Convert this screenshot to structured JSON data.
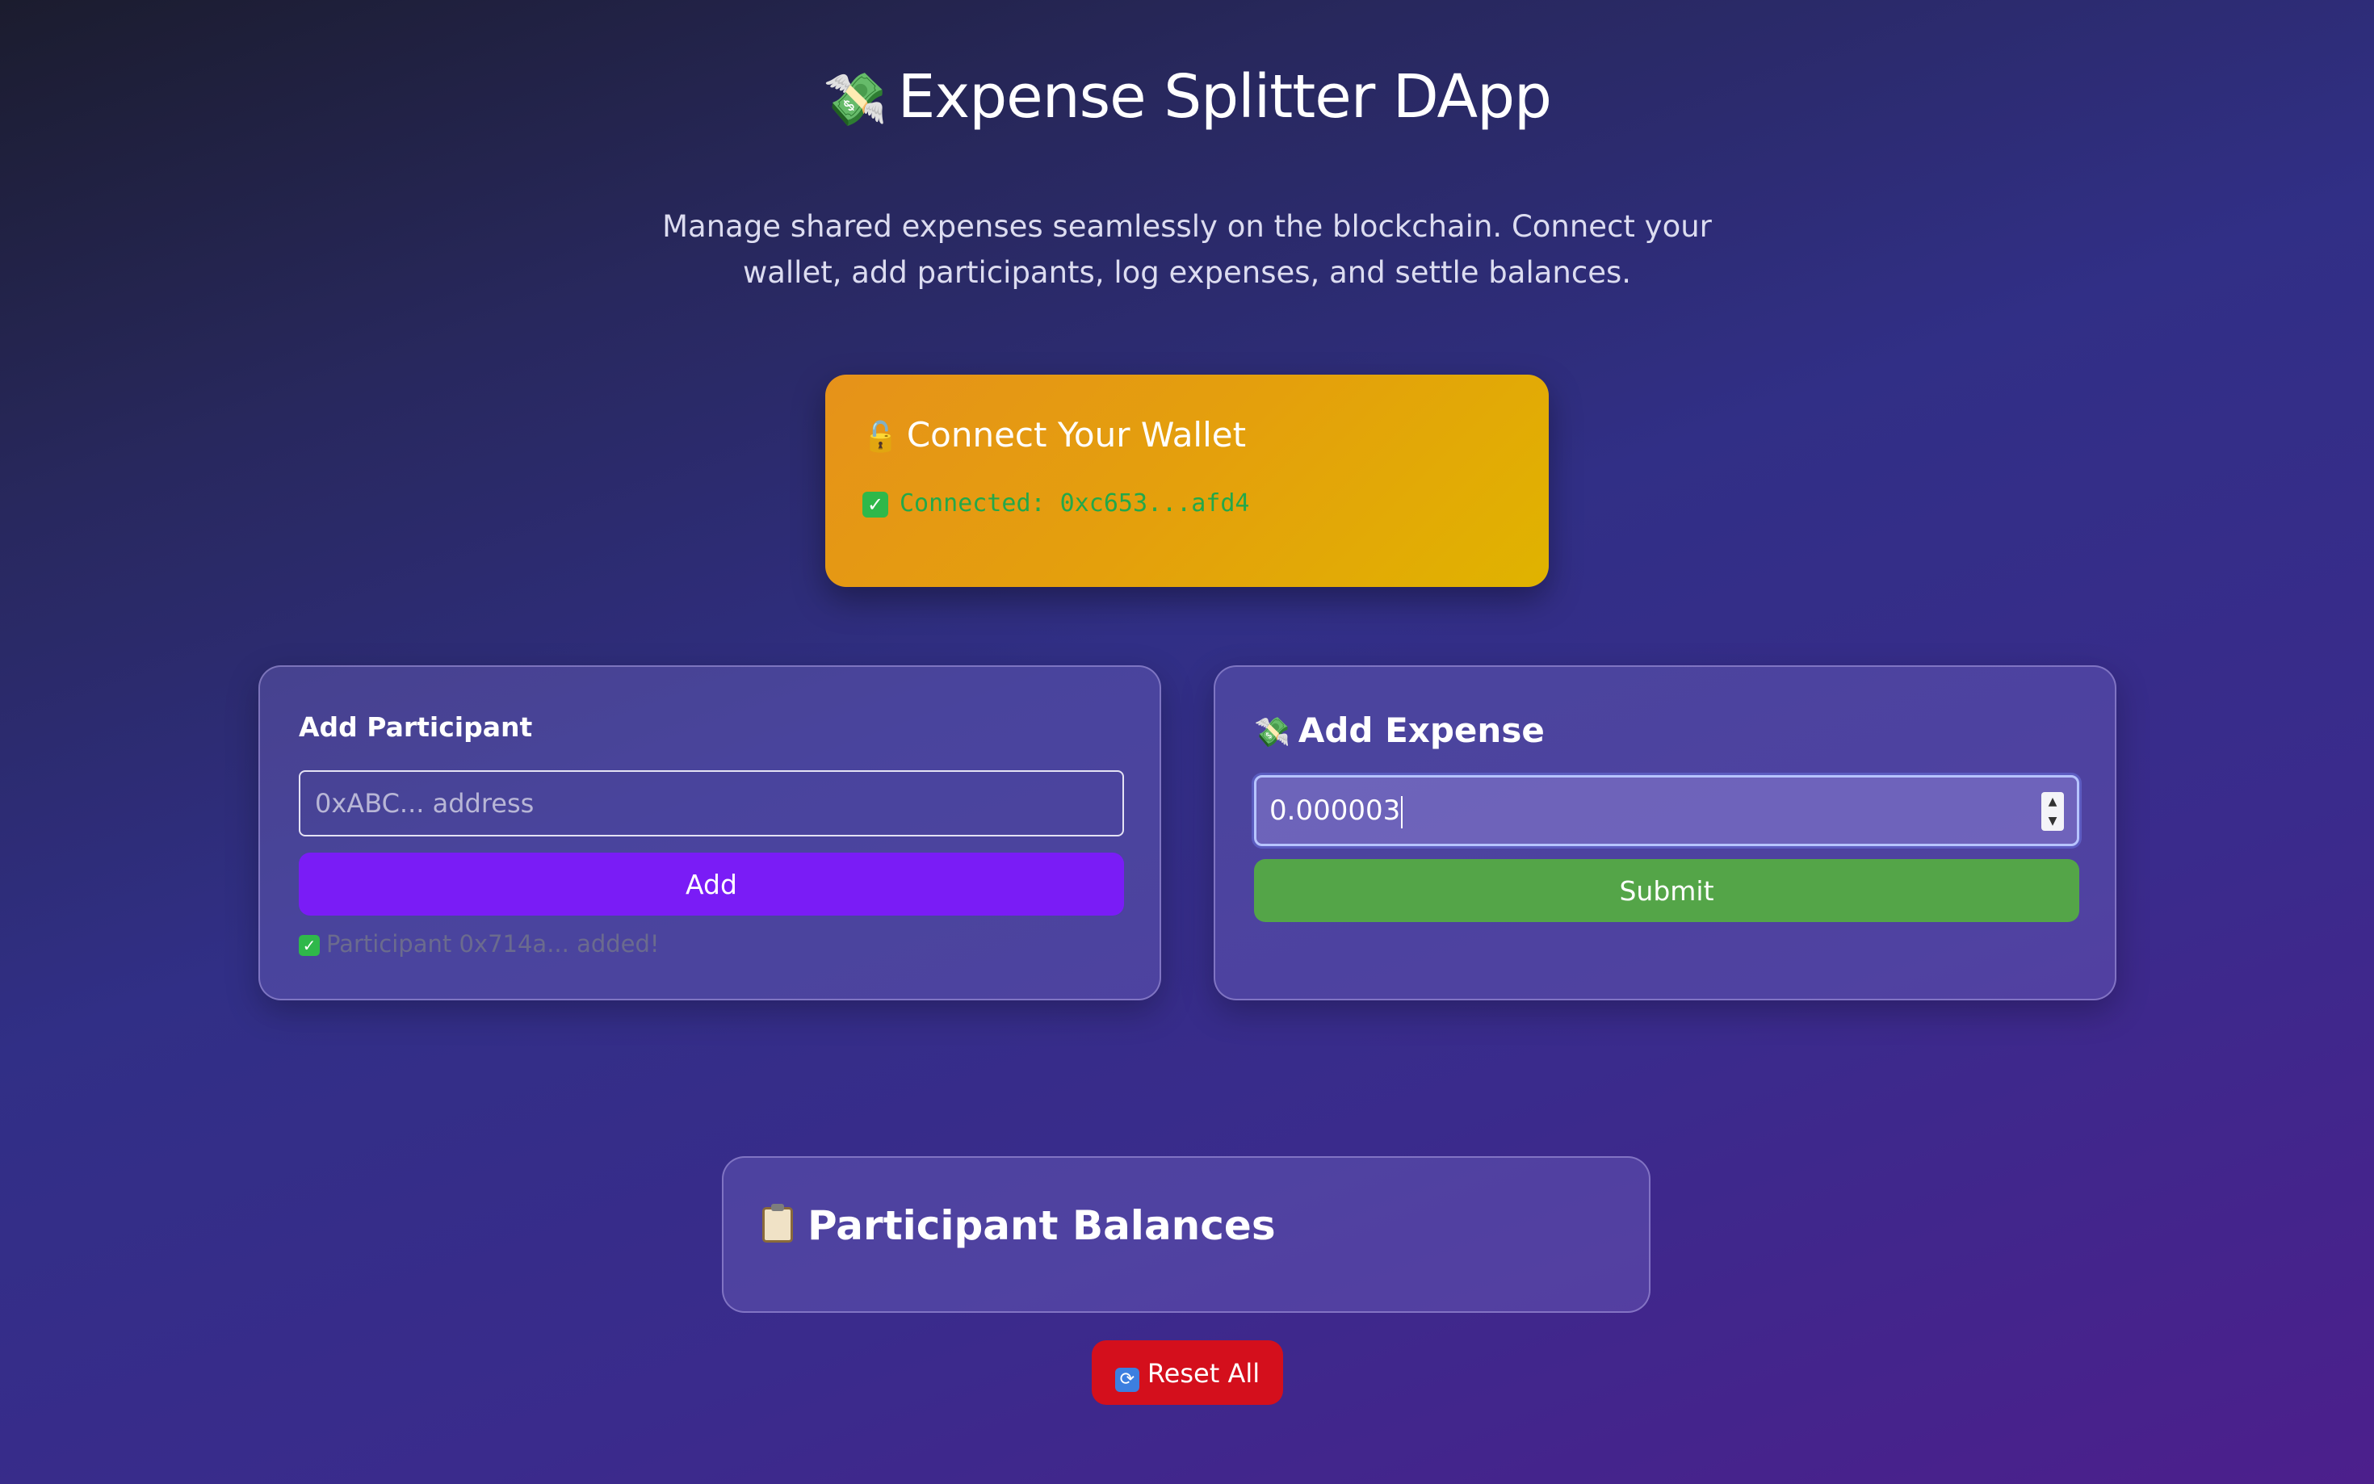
{
  "header": {
    "title_emoji": "💸",
    "title": "Expense Splitter DApp",
    "subtitle": "Manage shared expenses seamlessly on the blockchain. Connect your wallet, add participants, log expenses, and settle balances."
  },
  "wallet": {
    "title_emoji": "🔓",
    "title": "Connect Your Wallet",
    "status_icon": "check-icon",
    "status": "Connected: 0xc653...afd4"
  },
  "add_participant": {
    "title": "Add Participant",
    "address_placeholder": "0xABC... address",
    "address_value": "",
    "button_label": "Add",
    "message": "Participant 0x714a... added!"
  },
  "add_expense": {
    "title_emoji": "💸",
    "title": "Add Expense",
    "amount_value": "0.000003",
    "button_label": "Submit"
  },
  "balances": {
    "icon": "clipboard-icon",
    "title": "Participant Balances"
  },
  "reset": {
    "icon": "refresh-icon",
    "label": "Reset All"
  },
  "colors": {
    "wallet_card": "#e4a00c",
    "connected_text": "#22a84a",
    "add_button": "#7a1cf6",
    "submit_button": "#54a548",
    "reset_button": "#d40f1c"
  }
}
